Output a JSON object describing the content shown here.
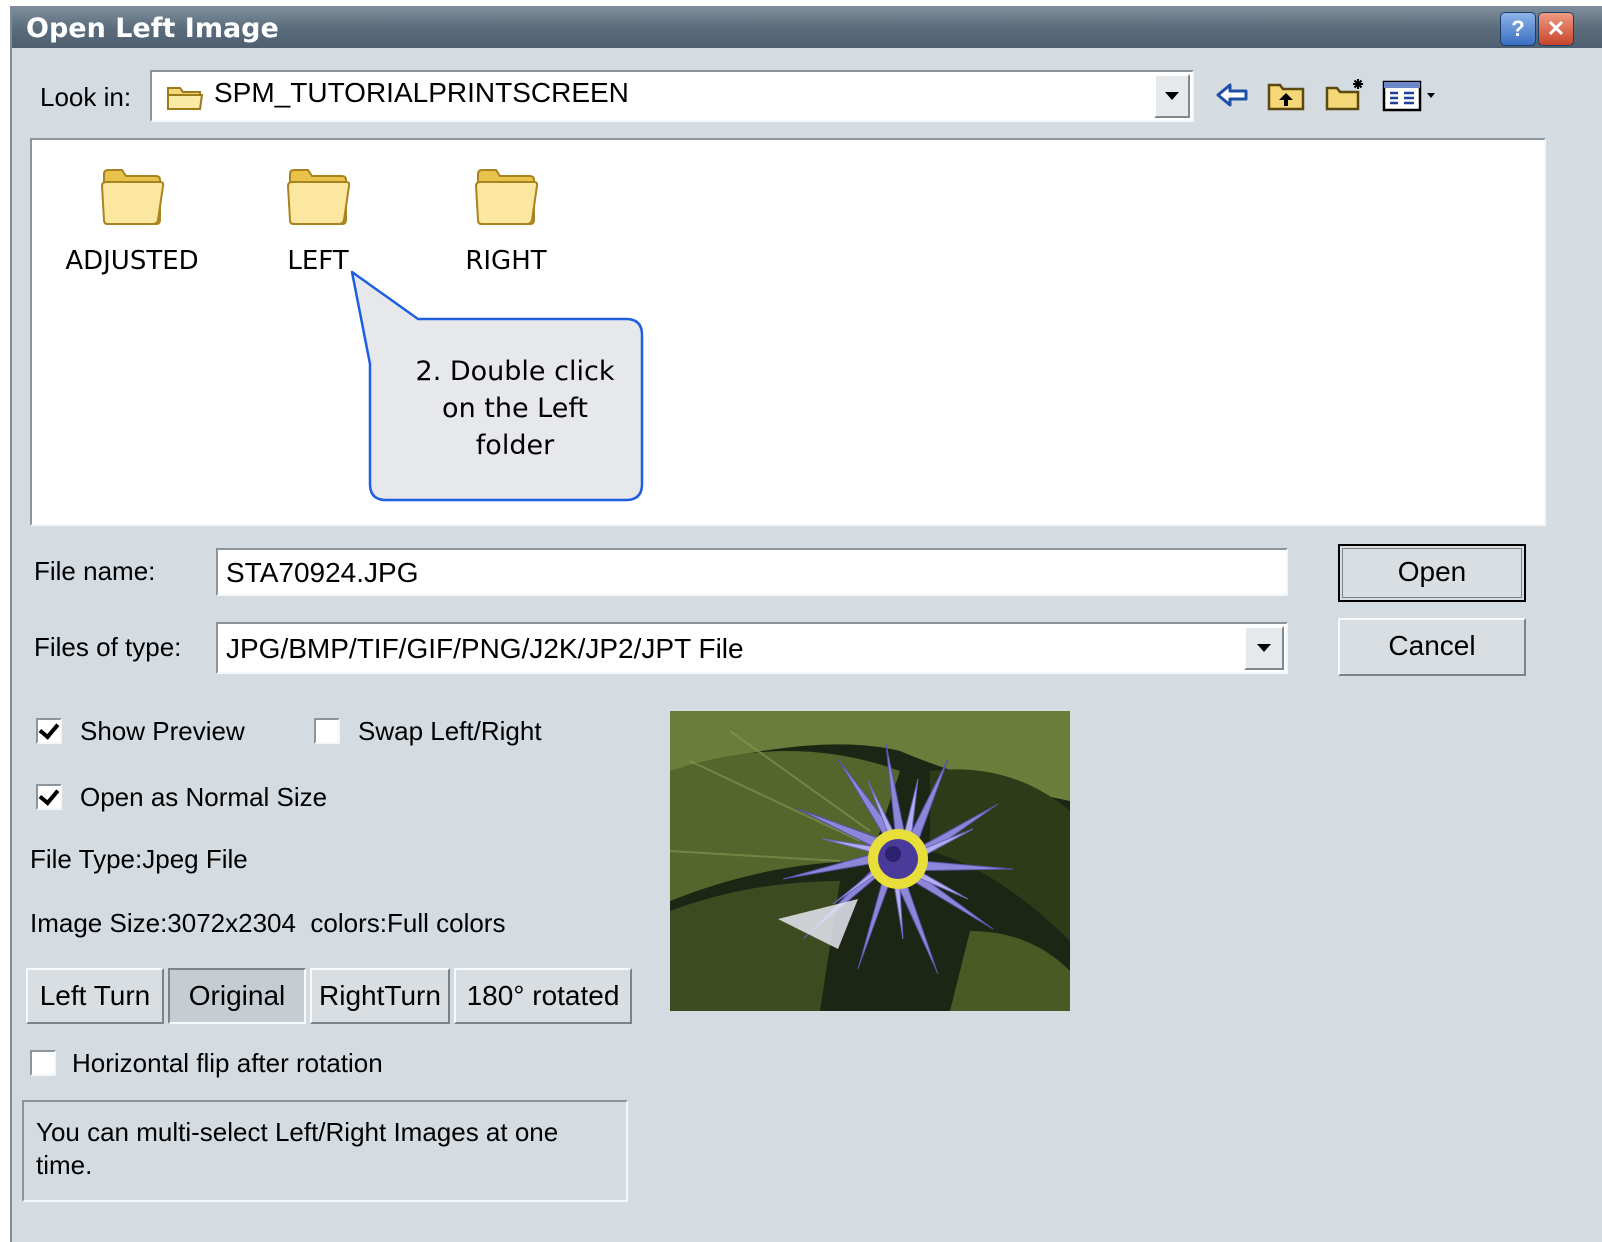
{
  "window": {
    "title": "Open Left Image"
  },
  "titlebar": {
    "help_icon": "help-icon",
    "close_icon": "close-icon"
  },
  "look_in": {
    "label": "Look in:",
    "value": "SPM_TUTORIALPRINTSCREEN",
    "icons": [
      "back-arrow-icon",
      "up-folder-icon",
      "new-folder-icon",
      "view-menu-icon"
    ]
  },
  "folders": [
    {
      "name": "ADJUSTED"
    },
    {
      "name": "LEFT"
    },
    {
      "name": "RIGHT"
    }
  ],
  "callout": {
    "text_lines": [
      "2. Double click",
      "on the Left",
      "folder"
    ]
  },
  "file_name": {
    "label": "File name:",
    "value": "STA70924.JPG"
  },
  "file_type": {
    "label": "Files of type:",
    "value": "JPG/BMP/TIF/GIF/PNG/J2K/JP2/JPT File"
  },
  "buttons": {
    "open": "Open",
    "cancel": "Cancel"
  },
  "options": {
    "show_preview": {
      "label": "Show Preview",
      "checked": true
    },
    "swap": {
      "label": "Swap Left/Right",
      "checked": false
    },
    "normal_size": {
      "label": "Open as Normal Size",
      "checked": true
    },
    "hflip": {
      "label": "Horizontal flip after rotation",
      "checked": false
    }
  },
  "info": {
    "file_type": "File Type:Jpeg File",
    "image_size": "Image Size:3072x2304  colors:Full colors"
  },
  "rotation": {
    "left_turn": "Left Turn",
    "original": "Original",
    "right_turn": "RightTurn",
    "rotated_180": "180° rotated",
    "selected": "Original"
  },
  "note": "You can multi-select Left/Right Images at one time.",
  "preview": {
    "subject": "water-lily-photo"
  }
}
